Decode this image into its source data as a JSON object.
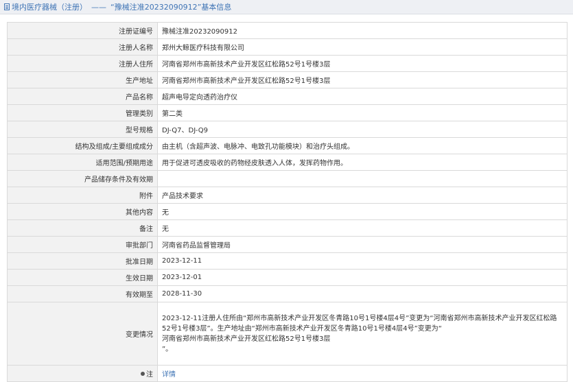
{
  "header": {
    "title_prefix": "境内医疗器械（注册）",
    "separator": "——",
    "title_suffix": "“豫械注准20232090912”基本信息"
  },
  "rows": [
    {
      "label": "注册证编号",
      "value": "豫械注准20232090912"
    },
    {
      "label": "注册人名称",
      "value": "郑州大鲸医疗科技有限公司"
    },
    {
      "label": "注册人住所",
      "value": "河南省郑州市高新技术产业开发区红松路52号1号楼3层"
    },
    {
      "label": "生产地址",
      "value": "河南省郑州市高新技术产业开发区红松路52号1号楼3层"
    },
    {
      "label": "产品名称",
      "value": "超声电导定向透药治疗仪"
    },
    {
      "label": "管理类别",
      "value": "第二类"
    },
    {
      "label": "型号规格",
      "value": "DJ-Q7、DJ-Q9"
    },
    {
      "label": "结构及组成/主要组成成分",
      "value": "由主机（含超声波、电脉冲、电致孔功能模块）和治疗头组成。"
    },
    {
      "label": "适用范围/预期用途",
      "value": "用于促进可透皮吸收的药物经皮肤透入人体，发挥药物作用。"
    },
    {
      "label": "产品储存条件及有效期",
      "value": ""
    },
    {
      "label": "附件",
      "value": "产品技术要求"
    },
    {
      "label": "其他内容",
      "value": "无"
    },
    {
      "label": "备注",
      "value": "无"
    },
    {
      "label": "审批部门",
      "value": "河南省药品监督管理局"
    },
    {
      "label": "批准日期",
      "value": "2023-12-11"
    },
    {
      "label": "生效日期",
      "value": "2023-12-01"
    },
    {
      "label": "有效期至",
      "value": "2028-11-30"
    }
  ],
  "change_row": {
    "label": "变更情况",
    "lines": [
      "2023-12-11注册人住所由“郑州市高新技术产业开发区冬青路10号1号楼4层4号”变更为“河南省郑州市高新技术产业开发区红松路",
      "52号1号楼3层”。生产地址由“郑州市高新技术产业开发区冬青路10号1号楼4层4号”变更为“",
      "河南省郑州市高新技术产业开发区红松路52号1号楼3层",
      "”。"
    ]
  },
  "note_row": {
    "label": "注",
    "link": "详情"
  },
  "colors": {
    "header_bg": "#eef0f4",
    "link": "#3f74b5",
    "label_bg": "#f2f2f2",
    "border": "#d9d9d9"
  }
}
